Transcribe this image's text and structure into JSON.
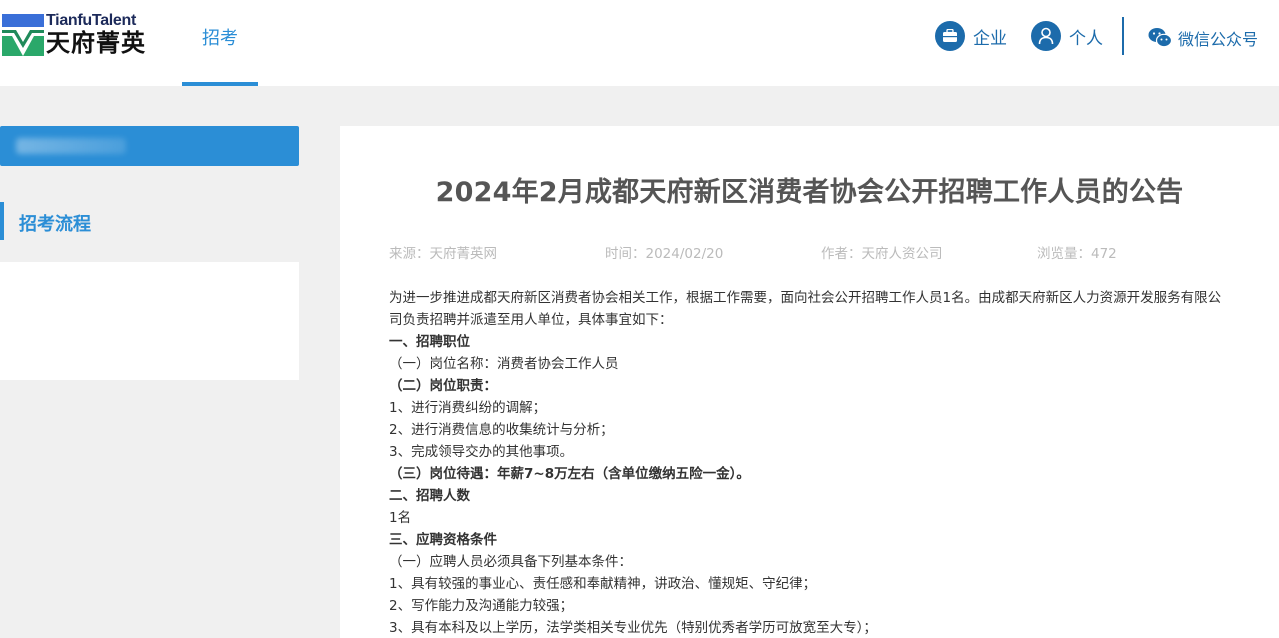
{
  "header": {
    "logo_en": "TianfuTalent",
    "logo_zh": "天府菁英",
    "nav_tab": "招考",
    "enterprise_label": "企业",
    "personal_label": "个人",
    "wechat_label": "微信公众号",
    "colors": {
      "accent": "#2b8ed6",
      "dark_blue": "#1c6bab"
    }
  },
  "sidebar": {
    "active_item": "招考流程"
  },
  "article": {
    "title": "2024年2月成都天府新区消费者协会公开招聘工作人员的公告",
    "meta": {
      "source_label": "来源：",
      "source": "天府菁英网",
      "time_label": "时间：",
      "time": "2024/02/20",
      "author_label": "作者：",
      "author": "天府人资公司",
      "views_label": "浏览量：",
      "views": "472"
    },
    "lines": [
      "为进一步推进成都天府新区消费者协会相关工作，根据工作需要，面向社会公开招聘工作人员1名。由成都天府新区人力资源开发服务有限公司负责招聘并派遣至用人单位，具体事宜如下：",
      "一、招聘职位",
      "（一）岗位名称：消费者协会工作人员",
      "（二）岗位职责：",
      "1、进行消费纠纷的调解；",
      "2、进行消费信息的收集统计与分析；",
      "3、完成领导交办的其他事项。",
      "（三）岗位待遇：年薪7~8万左右（含单位缴纳五险一金）。",
      "二、招聘人数",
      "1名",
      "三、应聘资格条件",
      "（一）应聘人员必须具备下列基本条件：",
      "1、具有较强的事业心、责任感和奉献精神，讲政治、懂规矩、守纪律；",
      "2、写作能力及沟通能力较强；",
      "3、具有本科及以上学历，法学类相关专业优先（特别优秀者学历可放宽至大专）；"
    ]
  }
}
